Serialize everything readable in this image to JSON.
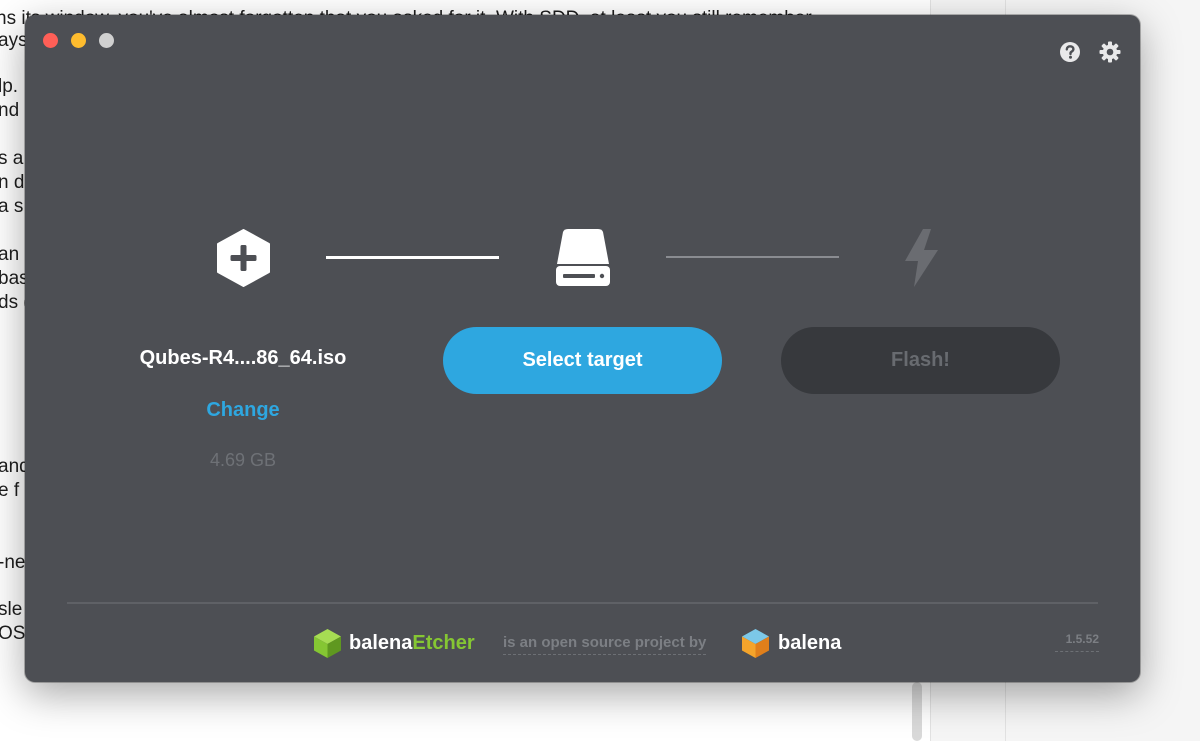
{
  "background_document": {
    "lines": [
      "ns its window, you've almost forgotten that you asked for it. With SDD, at least you still remember",
      "ays",
      "lp.",
      "nd r",
      "s a",
      "n do",
      "a s",
      "an",
      "bas",
      "ds (",
      "and",
      "e f",
      "-ne",
      "sle",
      "OS,"
    ]
  },
  "window": {
    "top_icons": {
      "help": "help-icon",
      "settings": "gear-icon"
    },
    "steps": {
      "image": {
        "icon": "plus-hexagon-icon",
        "file_name": "Qubes-R4....86_64.iso",
        "change_label": "Change",
        "file_size": "4.69 GB"
      },
      "drive": {
        "icon": "drive-icon",
        "button_label": "Select target"
      },
      "flash": {
        "icon": "lightning-icon",
        "button_label": "Flash!"
      }
    },
    "footer": {
      "brand_prefix": "balena",
      "brand_suffix": "Etcher",
      "tagline": "is an open source project by",
      "balena_label": "balena",
      "version": "1.5.52"
    }
  },
  "colors": {
    "window_bg": "#4d4f54",
    "accent_blue": "#2ea7e0",
    "etcher_green": "#85c633",
    "flash_disabled_bg": "#37393d"
  }
}
